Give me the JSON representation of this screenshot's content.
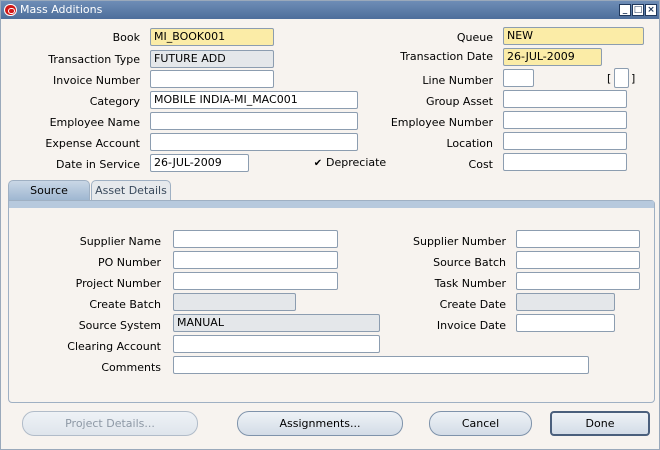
{
  "window": {
    "title": "Mass Additions"
  },
  "header": {
    "book": {
      "label": "Book",
      "value": "MI_BOOK001"
    },
    "queue": {
      "label": "Queue",
      "value": "NEW"
    },
    "transaction_type": {
      "label": "Transaction Type",
      "value": "FUTURE ADD"
    },
    "transaction_date": {
      "label": "Transaction Date",
      "value": "26-JUL-2009"
    },
    "invoice_number": {
      "label": "Invoice Number",
      "value": ""
    },
    "line_number": {
      "label": "Line Number",
      "value": ""
    },
    "bracket_field": {
      "value": ""
    },
    "category": {
      "label": "Category",
      "value": "MOBILE INDIA-MI_MAC001"
    },
    "group_asset": {
      "label": "Group Asset",
      "value": ""
    },
    "employee_name": {
      "label": "Employee Name",
      "value": ""
    },
    "employee_number": {
      "label": "Employee Number",
      "value": ""
    },
    "expense_account": {
      "label": "Expense Account",
      "value": ""
    },
    "location": {
      "label": "Location",
      "value": ""
    },
    "date_in_service": {
      "label": "Date in Service",
      "value": "26-JUL-2009"
    },
    "depreciate": {
      "label": "Depreciate",
      "checked": true
    },
    "cost": {
      "label": "Cost",
      "value": ""
    }
  },
  "tabs": [
    {
      "label": "Source",
      "active": true
    },
    {
      "label": "Asset Details",
      "active": false
    }
  ],
  "source": {
    "supplier_name": {
      "label": "Supplier Name",
      "value": ""
    },
    "supplier_number": {
      "label": "Supplier Number",
      "value": ""
    },
    "po_number": {
      "label": "PO Number",
      "value": ""
    },
    "source_batch": {
      "label": "Source Batch",
      "value": ""
    },
    "project_number": {
      "label": "Project Number",
      "value": ""
    },
    "task_number": {
      "label": "Task Number",
      "value": ""
    },
    "create_batch": {
      "label": "Create Batch",
      "value": ""
    },
    "create_date": {
      "label": "Create Date",
      "value": ""
    },
    "source_system": {
      "label": "Source System",
      "value": "MANUAL"
    },
    "invoice_date": {
      "label": "Invoice Date",
      "value": ""
    },
    "clearing_account": {
      "label": "Clearing Account",
      "value": ""
    },
    "comments": {
      "label": "Comments",
      "value": ""
    }
  },
  "buttons": {
    "project_details": "Project Details...",
    "assignments": "Assignments...",
    "cancel": "Cancel",
    "done": "Done"
  },
  "icons": [
    "oracle-app-icon",
    "minimize-icon",
    "maximize-icon",
    "close-icon",
    "checkmark-icon"
  ]
}
